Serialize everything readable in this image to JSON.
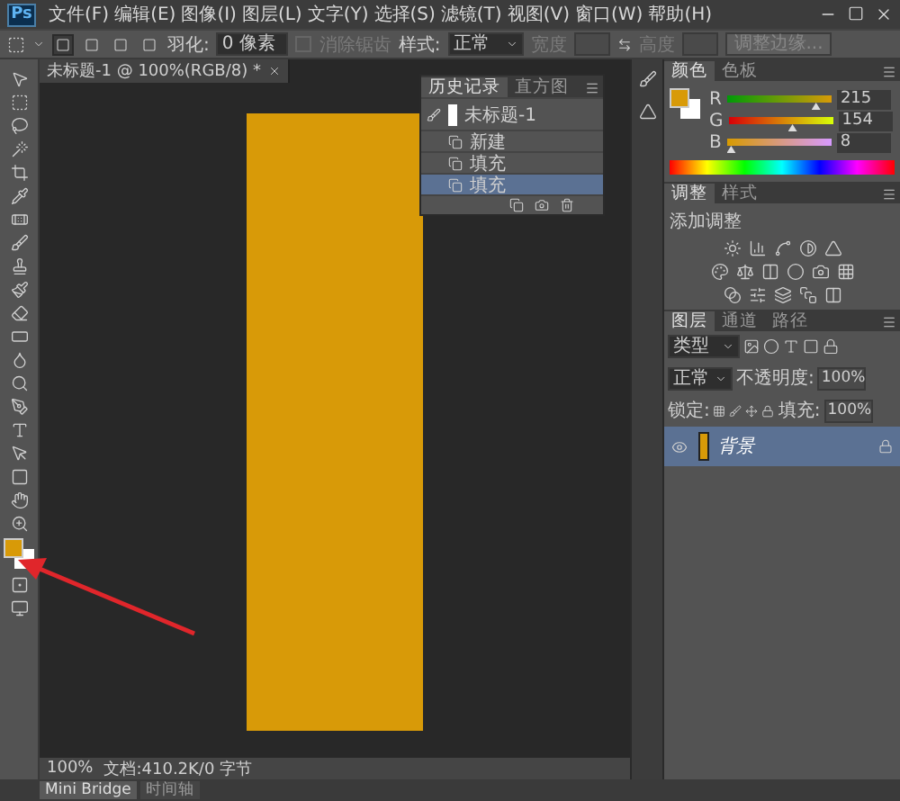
{
  "app": {
    "logo": "Ps"
  },
  "menu": [
    "文件(F)",
    "编辑(E)",
    "图像(I)",
    "图层(L)",
    "文字(Y)",
    "选择(S)",
    "滤镜(T)",
    "视图(V)",
    "窗口(W)",
    "帮助(H)"
  ],
  "options": {
    "feather_label": "羽化:",
    "feather_value": "0 像素",
    "antialias": {
      "label": "消除锯齿",
      "checked": false,
      "disabled": true
    },
    "style_label": "样式:",
    "style_value": "正常",
    "size_fields": [
      {
        "label": "宽度",
        "disabled": true
      },
      {
        "label": "高度",
        "disabled": true
      }
    ],
    "refine_button": "调整边缘..."
  },
  "document_tab": {
    "title": "未标题-1 @ 100%(RGB/8) *"
  },
  "history_panel": {
    "tabs": [
      {
        "label": "历史记录",
        "selected": true
      },
      {
        "label": "直方图",
        "selected": false
      }
    ],
    "snapshot": "未标题-1",
    "items": [
      {
        "label": "新建",
        "selected": false
      },
      {
        "label": "填充",
        "selected": false
      },
      {
        "label": "填充",
        "selected": true
      }
    ]
  },
  "color_panel": {
    "tabs": [
      {
        "label": "颜色",
        "selected": true
      },
      {
        "label": "色板",
        "selected": false
      }
    ],
    "channels": [
      {
        "name": "R",
        "value": "215",
        "level": 0.843
      },
      {
        "name": "G",
        "value": "154",
        "level": 0.604
      },
      {
        "name": "B",
        "value": "8",
        "level": 0.031
      }
    ]
  },
  "adjustments_panel": {
    "tabs": [
      {
        "label": "调整",
        "selected": true
      },
      {
        "label": "样式",
        "selected": false
      }
    ],
    "heading": "添加调整"
  },
  "layers_panel": {
    "tabs": [
      {
        "label": "图层",
        "selected": true
      },
      {
        "label": "通道",
        "selected": false
      },
      {
        "label": "路径",
        "selected": false
      }
    ],
    "filter": "类型",
    "blend_mode": "正常",
    "opacity_label": "不透明度:",
    "opacity_value": "100%",
    "lock_label": "锁定:",
    "fill_label": "填充:",
    "fill_value": "100%",
    "layers": [
      {
        "name": "背景",
        "selected": true,
        "visible": true,
        "locked": true
      }
    ]
  },
  "status_bar": {
    "zoom": "100%",
    "doc_info": "文档:410.2K/0 字节"
  },
  "bottom_tabs": [
    {
      "label": "Mini Bridge",
      "selected": true
    },
    {
      "label": "时间轴",
      "selected": false
    }
  ]
}
